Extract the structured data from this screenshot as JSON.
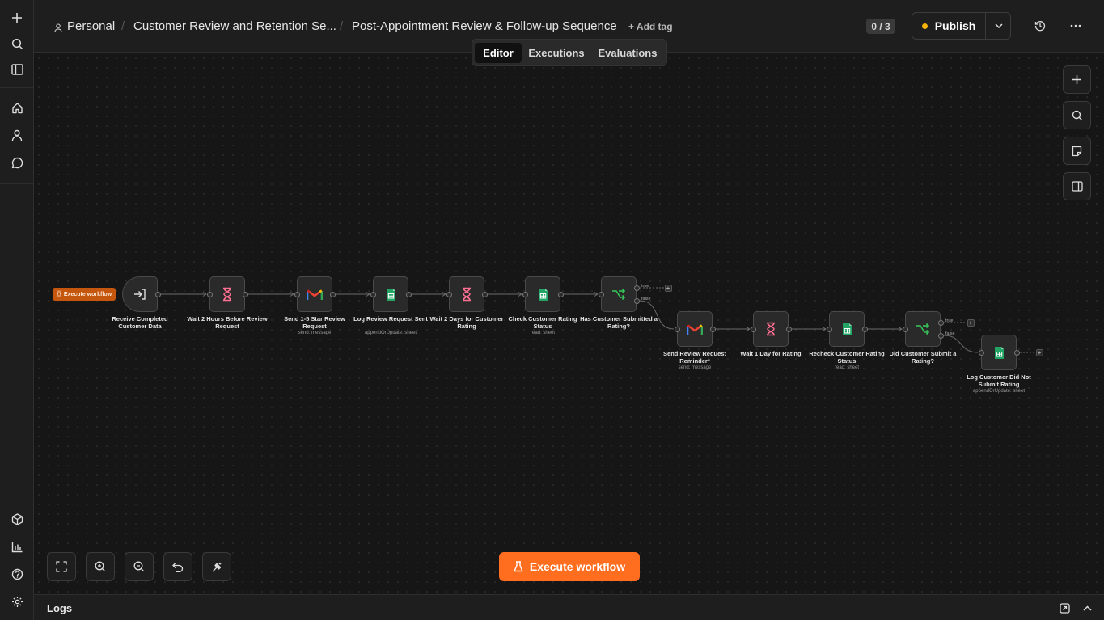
{
  "header": {
    "project": "Personal",
    "folder": "Customer Review and Retention Se...",
    "workflow_name": "Post-Appointment Review & Follow-up Sequence",
    "add_tag": "+ Add tag",
    "counter": "0 / 3",
    "publish_label": "Publish"
  },
  "tabs": [
    {
      "label": "Editor",
      "active": true
    },
    {
      "label": "Executions",
      "active": false
    },
    {
      "label": "Evaluations",
      "active": false
    }
  ],
  "canvas": {
    "execute_small": "Execute workflow",
    "nodes": [
      {
        "label": "Receive Completed Customer Data",
        "sub": "",
        "icon": "sign-in-icon"
      },
      {
        "label": "Wait 2 Hours Before Review Request",
        "sub": "",
        "icon": "hourglass-icon"
      },
      {
        "label": "Send 1-5 Star Review Request",
        "sub": "send: message",
        "icon": "gmail-icon"
      },
      {
        "label": "Log Review Request Sent",
        "sub": "appendOrUpdate: sheet",
        "icon": "google-sheets-icon"
      },
      {
        "label": "Wait 2 Days for Customer Rating",
        "sub": "",
        "icon": "hourglass-icon"
      },
      {
        "label": "Check Customer Rating Status",
        "sub": "read: sheet",
        "icon": "google-sheets-icon"
      },
      {
        "label": "Has Customer Submitted a Rating?",
        "sub": "",
        "icon": "if-branch-icon"
      },
      {
        "label": "Send Review Request Reminder*",
        "sub": "send: message",
        "icon": "gmail-icon"
      },
      {
        "label": "Wait 1 Day for Rating",
        "sub": "",
        "icon": "hourglass-icon"
      },
      {
        "label": "Recheck Customer Rating Status",
        "sub": "read: sheet",
        "icon": "google-sheets-icon"
      },
      {
        "label": "Did Customer Submit a Rating?",
        "sub": "",
        "icon": "if-branch-icon"
      },
      {
        "label": "Log Customer Did Not Submit Rating",
        "sub": "appendOrUpdate: sheet",
        "icon": "google-sheets-icon"
      }
    ],
    "branch_true": "true",
    "branch_false": "false",
    "execute_main": "Execute workflow"
  },
  "logs": {
    "label": "Logs"
  },
  "colors": {
    "accent": "#ff6d1f",
    "publish_dot": "#f5b40c",
    "wait_icon": "#ff6f91",
    "sheets_green": "#21a464",
    "if_green": "#35c759"
  }
}
